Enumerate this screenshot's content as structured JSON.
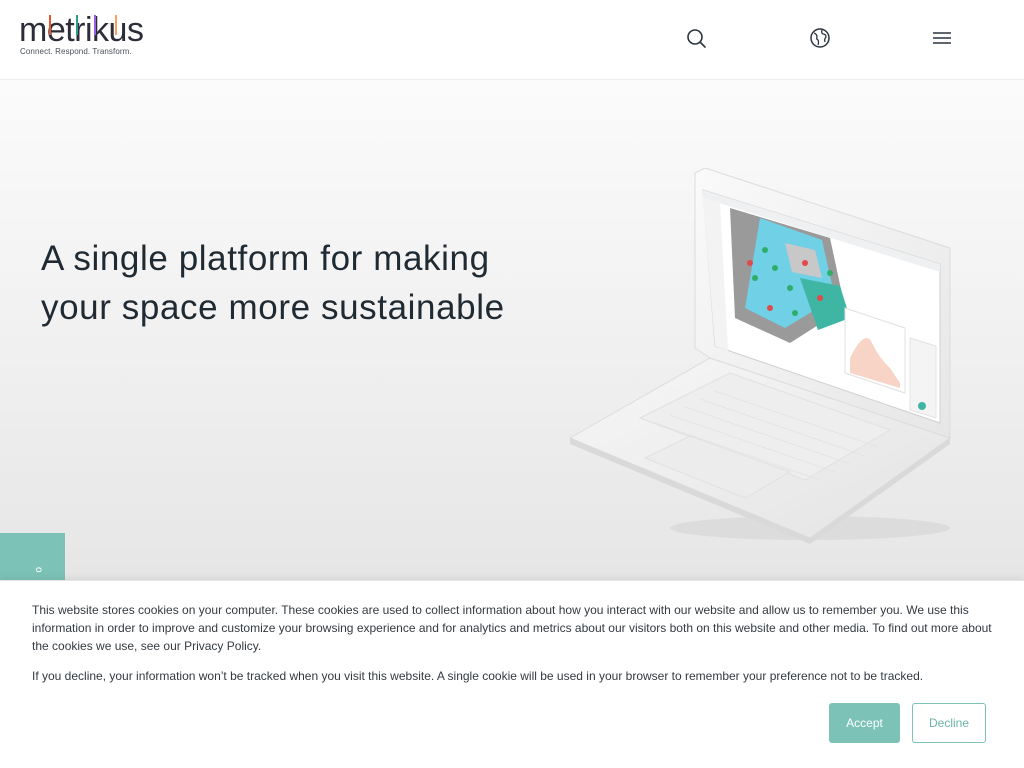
{
  "header": {
    "logo_text": "metrikus",
    "logo_tagline": "Connect. Respond. Transform.",
    "icons": [
      "search-icon",
      "globe-icon",
      "menu-icon"
    ],
    "logo_accent_colors": [
      "#e4572e",
      "#2a9d8f",
      "#9b5de5",
      "#f4a261"
    ]
  },
  "hero": {
    "title_line1": "A single platform for making",
    "title_line2": "your space more sustainable",
    "image": "laptop-dashboard-illustration"
  },
  "side_tab": {
    "label": "o"
  },
  "cookie_banner": {
    "text_main": "This website stores cookies on your computer. These cookies are used to collect information about how you interact with our website and allow us to remember you. We use this information in order to improve and customize your browsing experience and for analytics and metrics about our visitors both on this website and other media. To find out more about the cookies we use, see our ",
    "link_text": "Privacy Policy",
    "text_after_link": ".",
    "text_decline_info": "If you decline, your information won’t be tracked when you visit this website. A single cookie will be used in your browser to remember your preference not to be tracked.",
    "accept_label": "Accept",
    "decline_label": "Decline"
  },
  "colors": {
    "accent": "#7cc2b7",
    "text": "#1f2a33"
  }
}
